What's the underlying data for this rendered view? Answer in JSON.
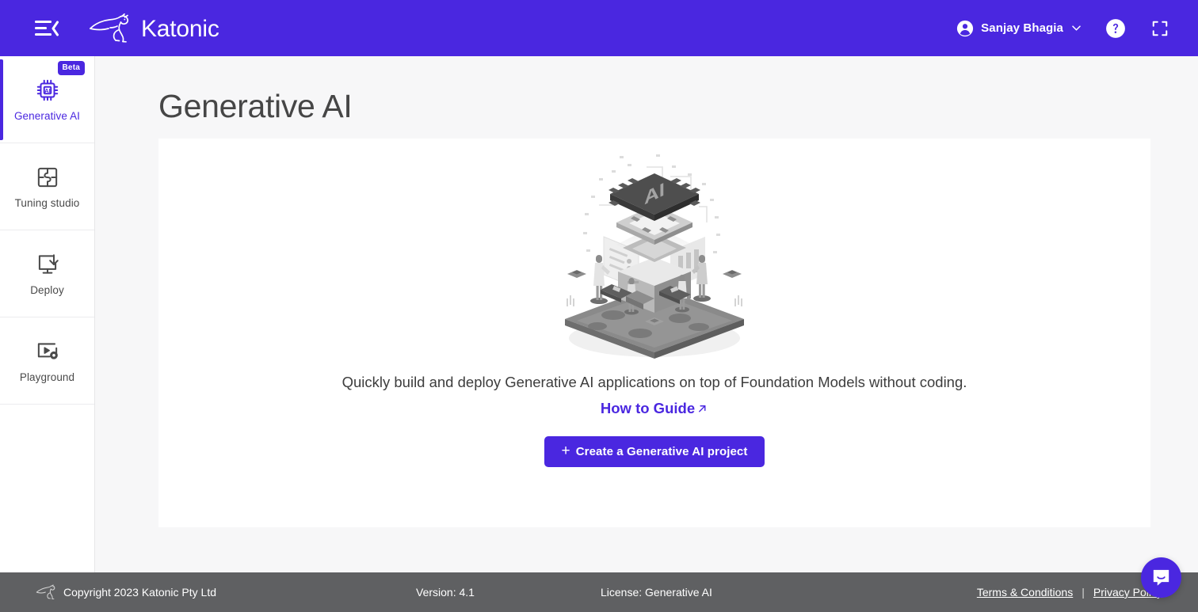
{
  "header": {
    "menu_toggle_icon": "hamburger-collapse-icon",
    "logo_icon": "katonic-kangaroo-logo",
    "brand": "Katonic",
    "user_name": "Sanjay Bhagia",
    "user_avatar_icon": "account-circle-icon",
    "chevron_icon": "chevron-down-icon",
    "help_icon": "help-circle-icon",
    "fullscreen_icon": "fullscreen-expand-icon",
    "accent_color": "#4a27e0"
  },
  "sidebar": {
    "items": [
      {
        "label": "Generative AI",
        "icon": "ai-chip-icon",
        "badge": "Beta",
        "active": true
      },
      {
        "label": "Tuning studio",
        "icon": "puzzle-pieces-icon",
        "badge": "",
        "active": false
      },
      {
        "label": "Deploy",
        "icon": "monitor-download-icon",
        "badge": "",
        "active": false
      },
      {
        "label": "Playground",
        "icon": "play-settings-icon",
        "badge": "",
        "active": false
      }
    ]
  },
  "main": {
    "page_title": "Generative AI",
    "illustration_icon": "isometric-ai-platform-illustration",
    "description": "Quickly build and deploy Generative AI applications on top of Foundation Models without coding.",
    "how_to_guide_label": "How to Guide",
    "external_link_icon": "external-link-arrow-icon",
    "create_button_plus": "+",
    "create_button_label": "Create a Generative AI project"
  },
  "footer": {
    "logo_icon": "katonic-kangaroo-mark",
    "copyright": "Copyright 2023 Katonic Pty Ltd",
    "version": "Version: 4.1",
    "license": "License: Generative AI",
    "terms_label": "Terms & Conditions",
    "separator": "|",
    "privacy_label": "Privacy Policy",
    "background_color": "#5f6062"
  },
  "intercom": {
    "icon": "intercom-chat-bubble-icon",
    "color": "#4a27e0"
  }
}
